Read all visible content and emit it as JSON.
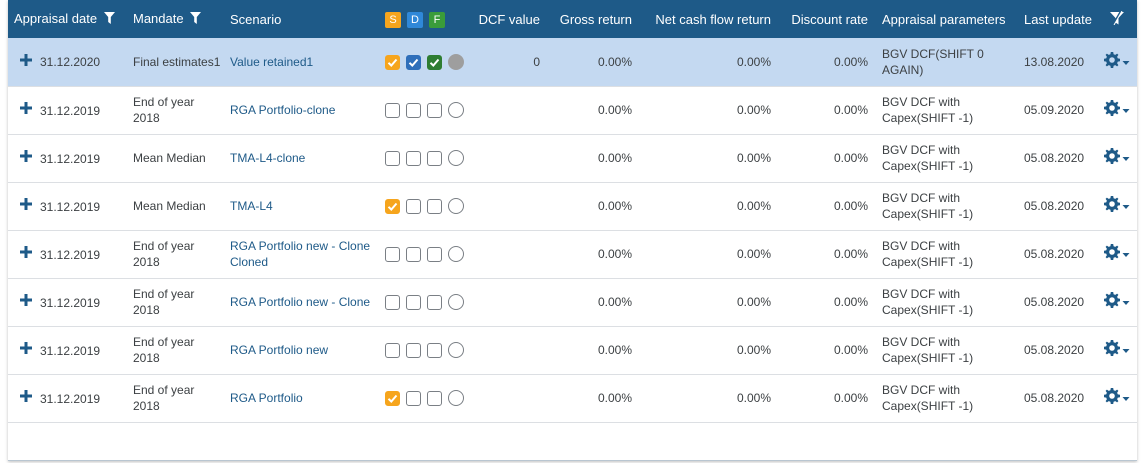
{
  "headers": {
    "appraisal_date": "Appraisal date",
    "mandate": "Mandate",
    "scenario": "Scenario",
    "badge_s": "S",
    "badge_d": "D",
    "badge_f": "F",
    "dcf_value": "DCF value",
    "gross_return": "Gross return",
    "net_cash_flow_return": "Net cash flow return",
    "discount_rate": "Discount rate",
    "appraisal_parameters": "Appraisal parameters",
    "last_update": "Last update"
  },
  "colors": {
    "header_bg": "#1e5a88",
    "selected_row": "#c4d9f1",
    "badge_s": "#f6a51d",
    "badge_d": "#2f88d8",
    "badge_f": "#3a9c3a",
    "icon": "#1e5a88"
  },
  "icons": {
    "filter": "filter-icon",
    "clear_filter": "filter-clear-icon",
    "expand": "plus-icon",
    "settings": "gear-icon",
    "dropdown": "caret-down-icon"
  },
  "rows": [
    {
      "date": "31.12.2020",
      "mandate": "Final estimates1",
      "scenario": "Value retained1",
      "s": true,
      "d": true,
      "f": true,
      "radio": true,
      "dcf": "0",
      "gross": "0.00%",
      "net": "0.00%",
      "discount": "0.00%",
      "params": "BGV DCF(SHIFT 0 AGAIN)",
      "updated": "13.08.2020",
      "selected": true
    },
    {
      "date": "31.12.2019",
      "mandate": "End of year 2018",
      "scenario": "RGA Portfolio-clone",
      "s": false,
      "d": false,
      "f": false,
      "radio": false,
      "dcf": "",
      "gross": "0.00%",
      "net": "0.00%",
      "discount": "0.00%",
      "params": "BGV DCF with Capex(SHIFT -1)",
      "updated": "05.09.2020",
      "selected": false
    },
    {
      "date": "31.12.2019",
      "mandate": "Mean Median",
      "scenario": "TMA-L4-clone",
      "s": false,
      "d": false,
      "f": false,
      "radio": false,
      "dcf": "",
      "gross": "0.00%",
      "net": "0.00%",
      "discount": "0.00%",
      "params": "BGV DCF with Capex(SHIFT -1)",
      "updated": "05.08.2020",
      "selected": false
    },
    {
      "date": "31.12.2019",
      "mandate": "Mean Median",
      "scenario": "TMA-L4",
      "s": true,
      "d": false,
      "f": false,
      "radio": false,
      "dcf": "",
      "gross": "0.00%",
      "net": "0.00%",
      "discount": "0.00%",
      "params": "BGV DCF with Capex(SHIFT -1)",
      "updated": "05.08.2020",
      "selected": false
    },
    {
      "date": "31.12.2019",
      "mandate": "End of year 2018",
      "scenario": "RGA Portfolio new - Clone Cloned",
      "s": false,
      "d": false,
      "f": false,
      "radio": false,
      "dcf": "",
      "gross": "0.00%",
      "net": "0.00%",
      "discount": "0.00%",
      "params": "BGV DCF with Capex(SHIFT -1)",
      "updated": "05.08.2020",
      "selected": false
    },
    {
      "date": "31.12.2019",
      "mandate": "End of year 2018",
      "scenario": "RGA Portfolio new - Clone",
      "s": false,
      "d": false,
      "f": false,
      "radio": false,
      "dcf": "",
      "gross": "0.00%",
      "net": "0.00%",
      "discount": "0.00%",
      "params": "BGV DCF with Capex(SHIFT -1)",
      "updated": "05.08.2020",
      "selected": false
    },
    {
      "date": "31.12.2019",
      "mandate": "End of year 2018",
      "scenario": "RGA Portfolio new",
      "s": false,
      "d": false,
      "f": false,
      "radio": false,
      "dcf": "",
      "gross": "0.00%",
      "net": "0.00%",
      "discount": "0.00%",
      "params": "BGV DCF with Capex(SHIFT -1)",
      "updated": "05.08.2020",
      "selected": false
    },
    {
      "date": "31.12.2019",
      "mandate": "End of year 2018",
      "scenario": "RGA Portfolio",
      "s": true,
      "d": false,
      "f": false,
      "radio": false,
      "dcf": "",
      "gross": "0.00%",
      "net": "0.00%",
      "discount": "0.00%",
      "params": "BGV DCF with Capex(SHIFT -1)",
      "updated": "05.08.2020",
      "selected": false
    }
  ]
}
